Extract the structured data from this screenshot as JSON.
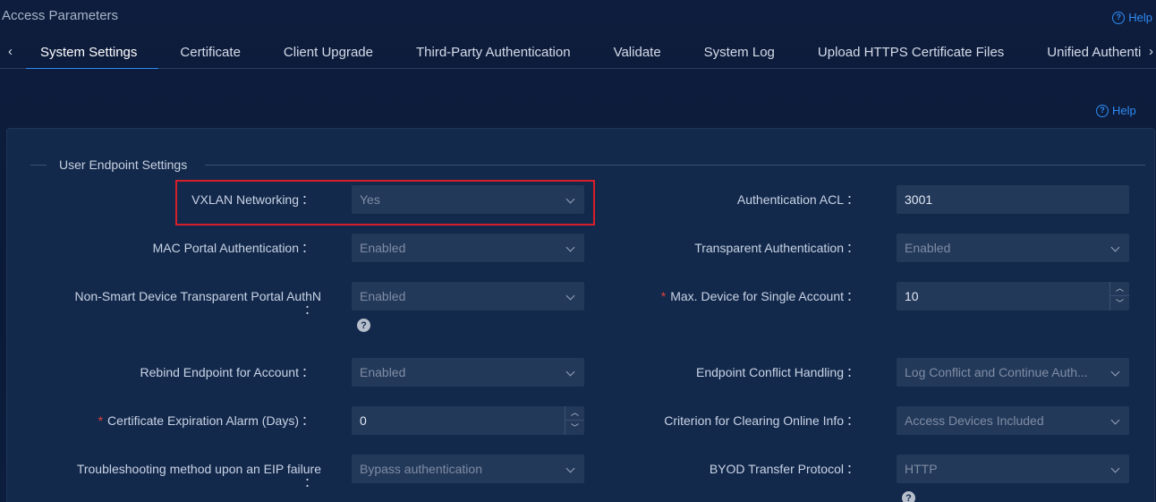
{
  "header": {
    "title": "Access Parameters",
    "help_label": "Help"
  },
  "tabs": [
    {
      "label": "System Settings",
      "active": true
    },
    {
      "label": "Certificate"
    },
    {
      "label": "Client Upgrade"
    },
    {
      "label": "Third-Party Authentication"
    },
    {
      "label": "Validate"
    },
    {
      "label": "System Log"
    },
    {
      "label": "Upload HTTPS Certificate Files"
    },
    {
      "label": "Unified Authenti"
    }
  ],
  "content": {
    "help_label": "Help",
    "section_title": "User Endpoint Settings",
    "colon": "：",
    "required_mark": "*",
    "help_mark": "?"
  },
  "fields": {
    "vxlan": {
      "label": "VXLAN Networking",
      "value": "Yes",
      "type": "select"
    },
    "auth_acl": {
      "label": "Authentication ACL",
      "value": "3001",
      "type": "input"
    },
    "mac_portal": {
      "label": "MAC Portal Authentication",
      "value": "Enabled",
      "type": "select"
    },
    "transparent_auth": {
      "label": "Transparent Authentication",
      "value": "Enabled",
      "type": "select"
    },
    "non_smart": {
      "label": "Non-Smart Device Transparent Portal AuthN",
      "value": "Enabled",
      "type": "select"
    },
    "max_device": {
      "label": "Max. Device for Single Account",
      "value": "10",
      "type": "number",
      "required": true
    },
    "rebind": {
      "label": "Rebind Endpoint for Account",
      "value": "Enabled",
      "type": "select"
    },
    "conflict": {
      "label": "Endpoint Conflict Handling",
      "value": "Log Conflict and Continue Auth...",
      "type": "select"
    },
    "cert_alarm": {
      "label": "Certificate Expiration Alarm (Days)",
      "value": "0",
      "type": "number",
      "required": true
    },
    "clearing_online": {
      "label": "Criterion for Clearing Online Info",
      "value": "Access Devices Included",
      "type": "select"
    },
    "eip_failure": {
      "label": "Troubleshooting method upon an EIP failure",
      "value": "Bypass authentication",
      "type": "select"
    },
    "byod_protocol": {
      "label": "BYOD Transfer Protocol",
      "value": "HTTP",
      "type": "select"
    }
  },
  "colors": {
    "background": "#0e1d3d",
    "panel": "#13294b",
    "control": "#23395a",
    "accent": "#2f8cf5",
    "required": "#e0413d",
    "highlight_border": "#d61f2a"
  }
}
